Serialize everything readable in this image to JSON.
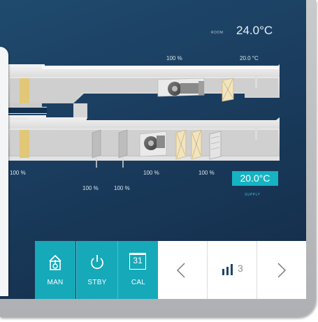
{
  "room": {
    "label": "ROOM",
    "temperature": "24.0°C"
  },
  "diagram": {
    "upper_percent": "100 %",
    "upper_temp": "20.0 °C",
    "left_percent": "100 %",
    "damper_a_percent": "100 %",
    "damper_b_percent": "100 %",
    "mid_percent_1": "100 %",
    "mid_percent_2": "100 %"
  },
  "supply": {
    "temperature": "20.0°C",
    "label": "SUPPLY"
  },
  "modes": [
    {
      "label": "MAN",
      "icon": "thermostat-icon"
    },
    {
      "label": "STBY",
      "icon": "power-icon"
    },
    {
      "label": "CAL",
      "icon": "calendar-icon",
      "day": "31"
    }
  ],
  "nav": {
    "prev": "<",
    "page": "3",
    "next": ">"
  },
  "colors": {
    "screen_bg": "#1c4064",
    "accent": "#16a9b9"
  }
}
